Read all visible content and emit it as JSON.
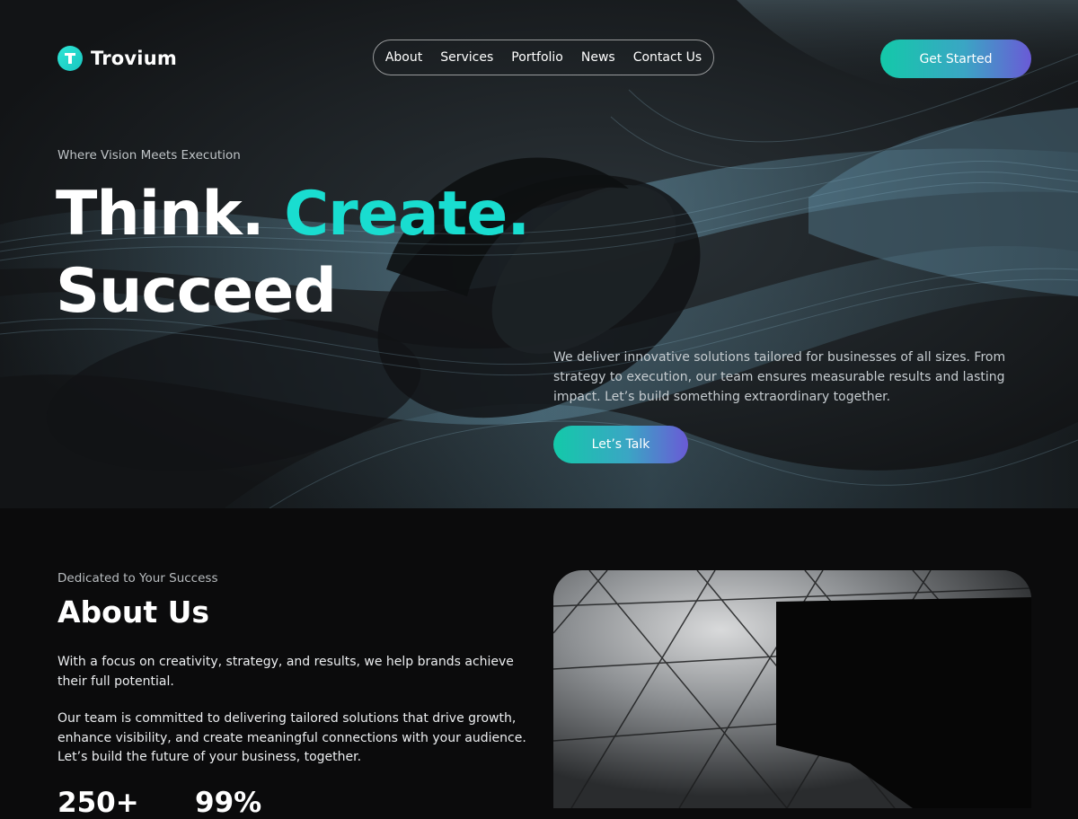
{
  "brand": {
    "name": "Trovium",
    "logo_letter": "T"
  },
  "nav": {
    "items": [
      "About",
      "Services",
      "Portfolio",
      "News",
      "Contact Us"
    ]
  },
  "header": {
    "cta_label": "Get Started"
  },
  "hero": {
    "eyebrow": "Where Vision Meets Execution",
    "headline_word1": "Think.",
    "headline_word2": "Create.",
    "headline_word3": "Succeed",
    "description": "We deliver innovative solutions tailored for businesses of all sizes. From strategy to execution, our team ensures measurable results and lasting impact. Let’s build something extraordinary together.",
    "cta_label": "Let’s Talk"
  },
  "about": {
    "eyebrow": "Dedicated to Your Success",
    "title": "About Us",
    "paragraph1": "With a focus on creativity, strategy, and results, we help brands achieve their full potential.",
    "paragraph2": "Our team is committed to delivering tailored solutions that drive growth, enhance visibility, and create meaningful connections with your audience. Let’s build the future of your business, together.",
    "stats": [
      {
        "value": "250+"
      },
      {
        "value": "99%"
      }
    ]
  },
  "colors": {
    "accent": "#19ddd0",
    "gradient_start": "#13c9a9",
    "gradient_end": "#6a5ad6",
    "background": "#0b0b0c"
  }
}
